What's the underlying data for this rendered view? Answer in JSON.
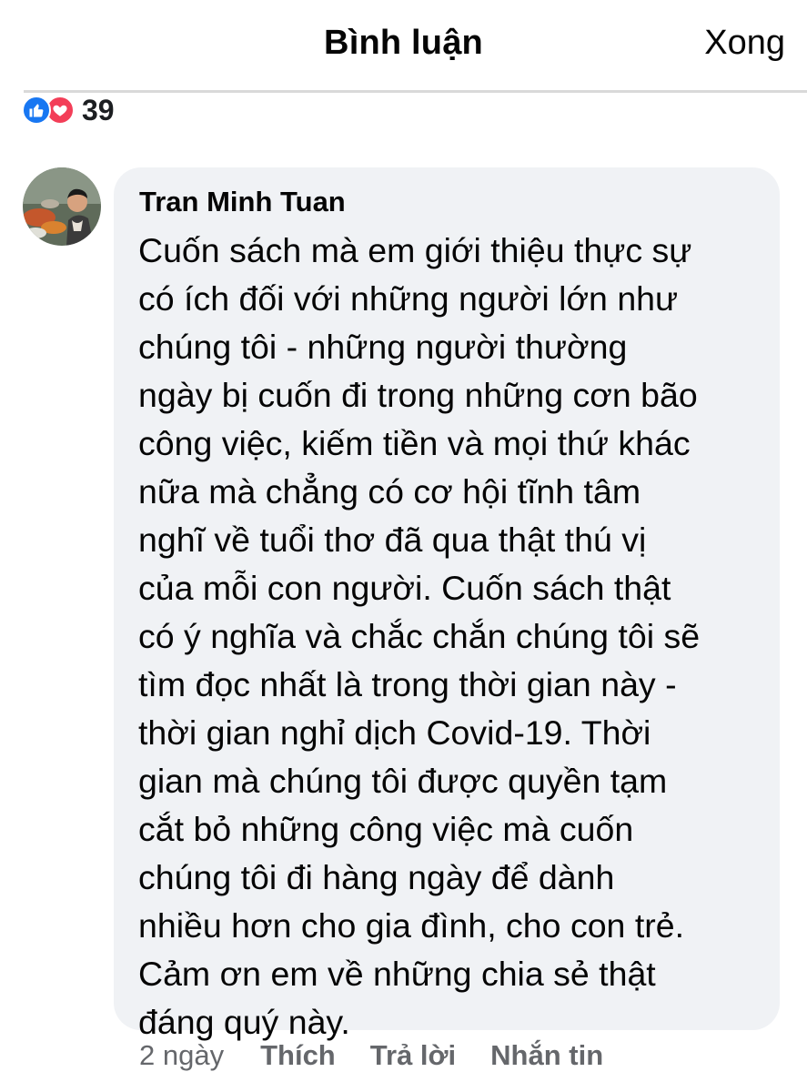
{
  "header": {
    "title": "Bình luận",
    "done_label": "Xong"
  },
  "reactions": {
    "icons": [
      "like-icon",
      "love-icon"
    ],
    "count": "39",
    "colors": {
      "like": "#1877f2",
      "love": "#f33e58"
    }
  },
  "comment": {
    "author": "Tran Minh Tuan",
    "lines": [
      "Cuốn sách mà em giới thiệu thực sự",
      "có ích đối với những người lớn như",
      "chúng tôi - những người thường",
      "ngày bị cuốn đi trong những cơn bão",
      "công việc, kiếm tiền và mọi thứ khác",
      "nữa mà chẳng có cơ hội tĩnh tâm",
      "nghĩ về tuổi thơ đã qua thật thú vị",
      "của mỗi con người. Cuốn sách thật",
      "có ý nghĩa và chắc chắn chúng tôi sẽ",
      "tìm đọc nhất là trong thời gian này -",
      "thời gian nghỉ dịch Covid-19. Thời",
      "gian mà chúng tôi được quyền tạm",
      "cắt bỏ những công việc mà cuốn",
      "chúng tôi đi hàng ngày để dành",
      "nhiều hơn cho gia đình, cho con trẻ.",
      "Cảm ơn em về những chia sẻ thật",
      "đáng quý này."
    ],
    "time": "2 ngày",
    "like_label": "Thích",
    "reply_label": "Trả lời",
    "message_label": "Nhắn tin"
  },
  "colors": {
    "bubble_background": "#f0f2f5",
    "secondary_text": "#65676b",
    "primary_text": "#050505"
  }
}
